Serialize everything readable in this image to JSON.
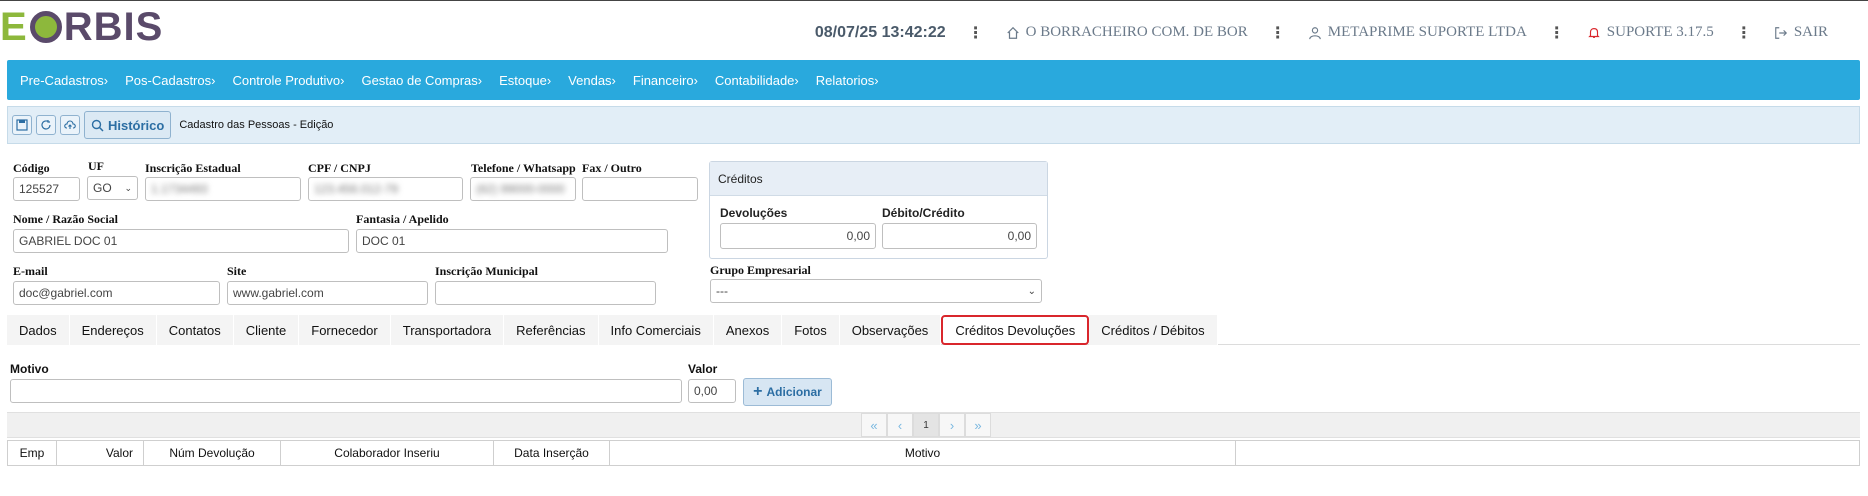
{
  "logo": {
    "e": "E",
    "rest": "RBIS"
  },
  "header": {
    "datetime": "08/07/25 13:42:22",
    "company": "O BORRACHEIRO COM. DE BOR",
    "user_company": "METAPRIME SUPORTE LTDA",
    "support": "SUPORTE 3.17.5",
    "logout": "SAIR"
  },
  "nav": [
    "Pre-Cadastros›",
    "Pos-Cadastros›",
    "Controle Produtivo›",
    "Gestao de Compras›",
    "Estoque›",
    "Vendas›",
    "Financeiro›",
    "Contabilidade›",
    "Relatorios›"
  ],
  "toolbar": {
    "history_label": "Histórico",
    "page_title": "Cadastro das Pessoas - Edição"
  },
  "form": {
    "codigo_label": "Código",
    "codigo_value": "125527",
    "uf_label": "UF",
    "uf_value": "GO",
    "ie_label": "Inscrição Estadual",
    "ie_value": "1.1734493",
    "cpf_label": "CPF / CNPJ",
    "cpf_value": "123.456.012-79",
    "tel_label": "Telefone / Whatsapp",
    "tel_value": "(62) 99000-0000",
    "fax_label": "Fax / Outro",
    "fax_value": "",
    "nome_label": "Nome / Razão Social",
    "nome_value": "GABRIEL DOC 01",
    "fantasia_label": "Fantasia / Apelido",
    "fantasia_value": "DOC 01",
    "email_label": "E-mail",
    "email_value": "doc@gabriel.com",
    "site_label": "Site",
    "site_value": "www.gabriel.com",
    "im_label": "Inscrição Municipal",
    "im_value": "",
    "grupo_label": "Grupo Empresarial",
    "grupo_value": "---"
  },
  "credits": {
    "title": "Créditos",
    "devolucoes_label": "Devoluções",
    "devolucoes_value": "0,00",
    "debito_label": "Débito/Crédito",
    "debito_value": "0,00"
  },
  "tabs": [
    "Dados",
    "Endereços",
    "Contatos",
    "Cliente",
    "Fornecedor",
    "Transportadora",
    "Referências",
    "Info Comerciais",
    "Anexos",
    "Fotos",
    "Observações",
    "Créditos Devoluções",
    "Créditos / Débitos"
  ],
  "active_tab": "Créditos Devoluções",
  "devolucao_form": {
    "motivo_label": "Motivo",
    "motivo_value": "",
    "valor_label": "Valor",
    "valor_value": "0,00",
    "add_label": "Adicionar"
  },
  "pager": {
    "first": "«",
    "prev": "‹",
    "current": "1",
    "next": "›",
    "last": "»"
  },
  "table": {
    "columns": [
      "Emp",
      "Valor",
      "Núm Devolução",
      "Colaborador Inseriu",
      "Data Inserção",
      "Motivo",
      ""
    ]
  },
  "colors": {
    "nav": "#29a9dd",
    "accent": "#2c6ea3",
    "active_tab_border": "#d9262c",
    "logo_green": "#8db83c",
    "logo_purple": "#5a4a6a"
  }
}
